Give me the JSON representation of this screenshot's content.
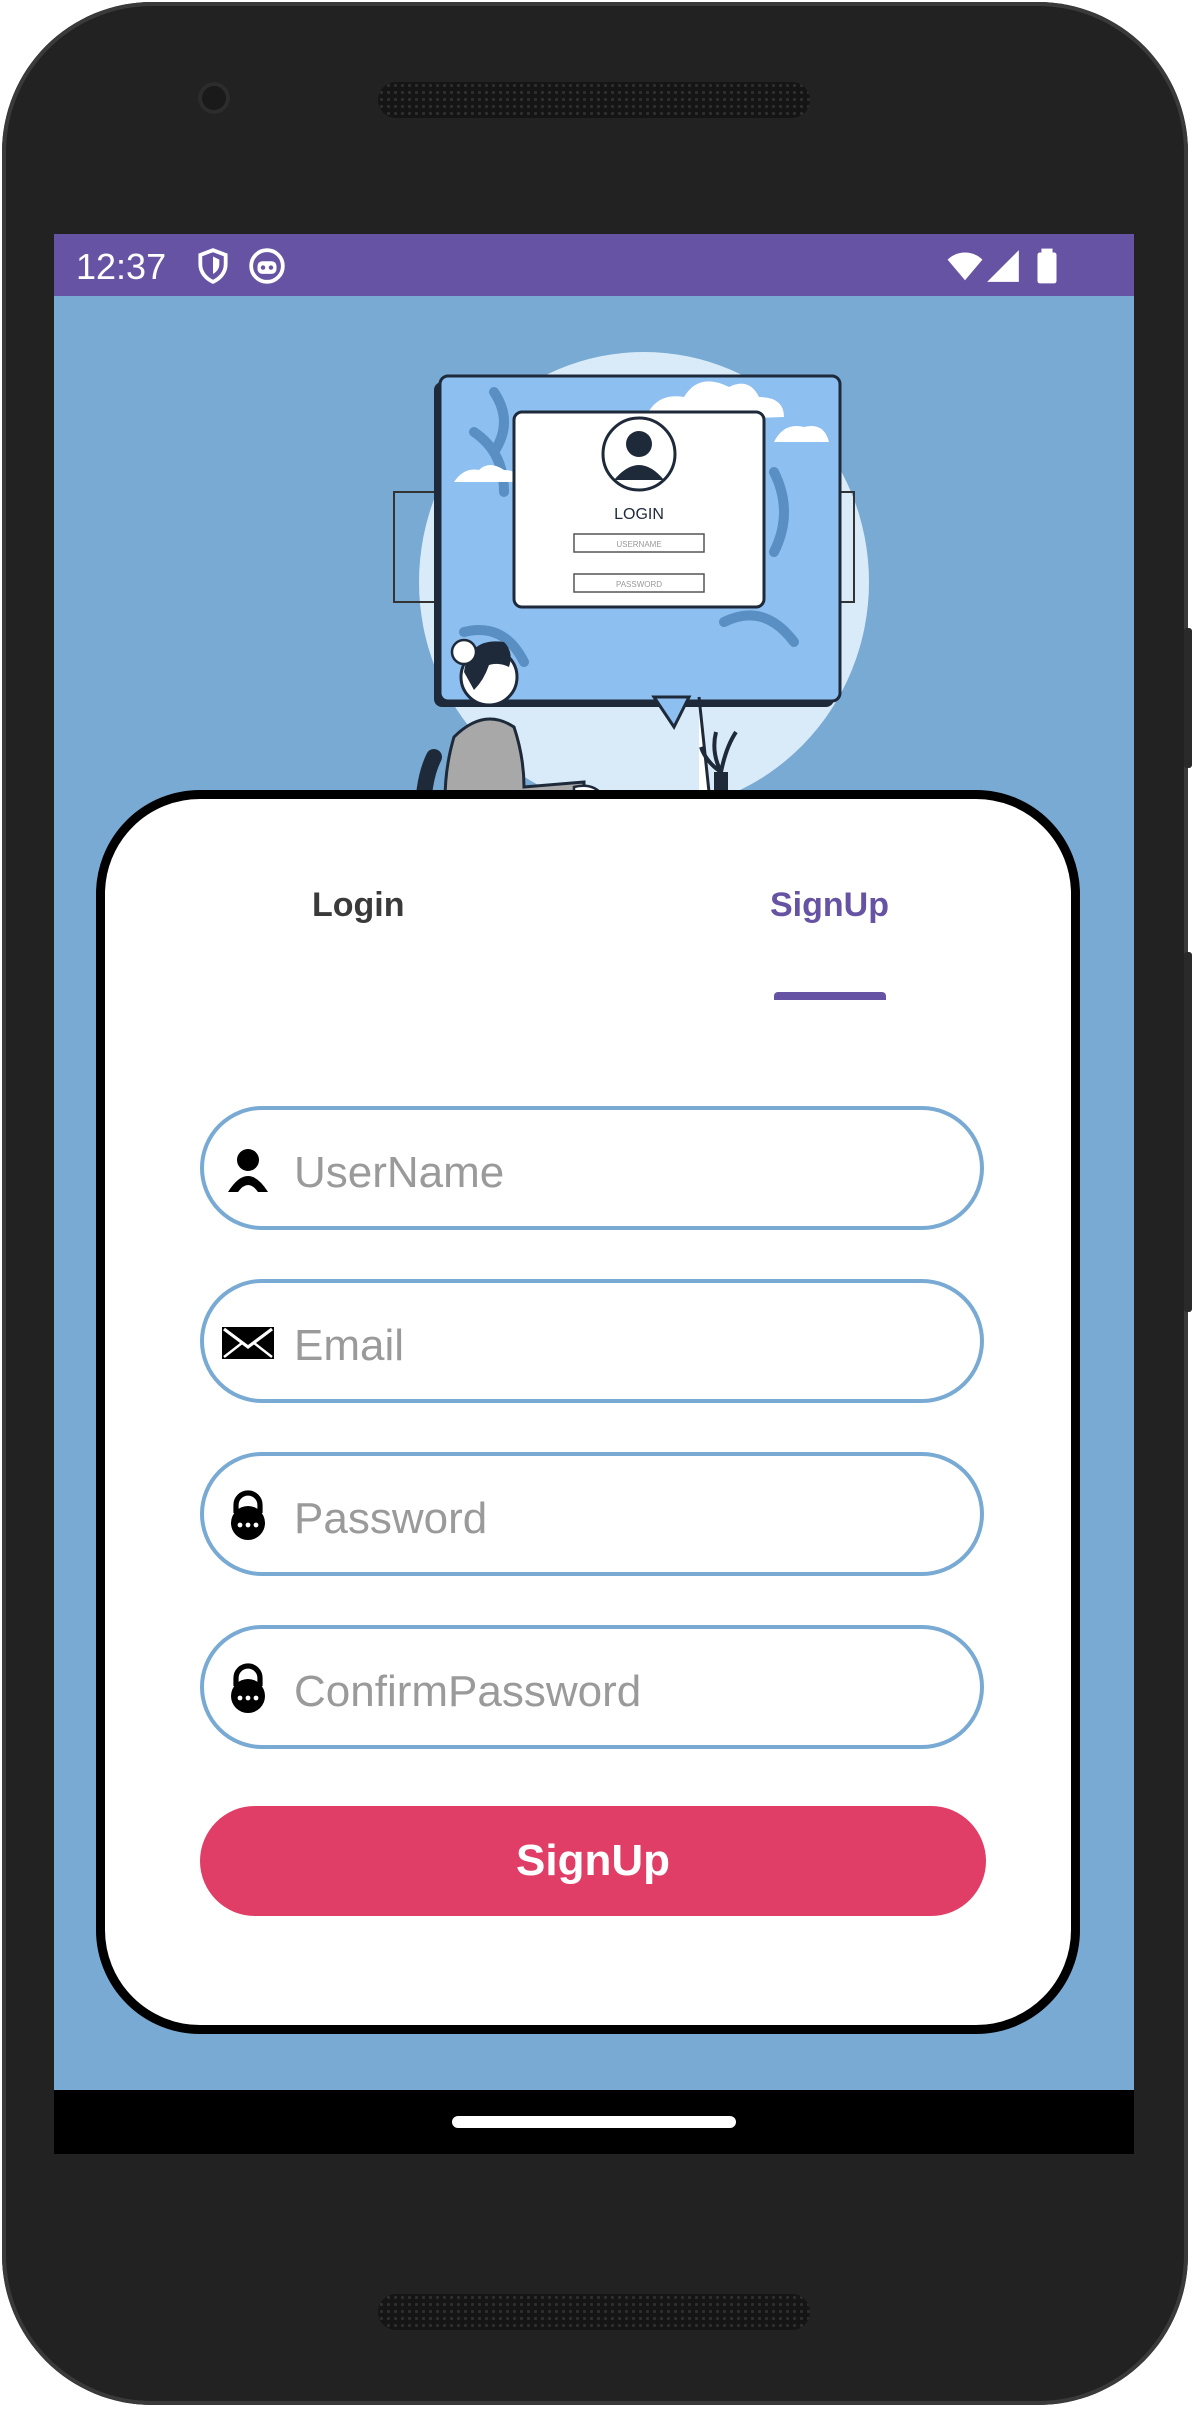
{
  "status_bar": {
    "time": "12:37"
  },
  "illustration": {
    "card_title": "LOGIN",
    "username_caption": "USERNAME",
    "password_caption": "PASSWORD"
  },
  "tabs": [
    {
      "label": "Login",
      "selected": false
    },
    {
      "label": "SignUp",
      "selected": true
    }
  ],
  "form": {
    "fields": [
      {
        "placeholder": "UserName",
        "icon": "user-icon"
      },
      {
        "placeholder": "Email",
        "icon": "envelope-icon"
      },
      {
        "placeholder": "Password",
        "icon": "lock-icon"
      },
      {
        "placeholder": "ConfirmPassword",
        "icon": "lock-icon"
      }
    ],
    "submit_label": "SignUp"
  },
  "colors": {
    "accent": "#6753a3",
    "background": "#78aad4",
    "button": "#e03e66",
    "field_border": "#78aad4"
  }
}
